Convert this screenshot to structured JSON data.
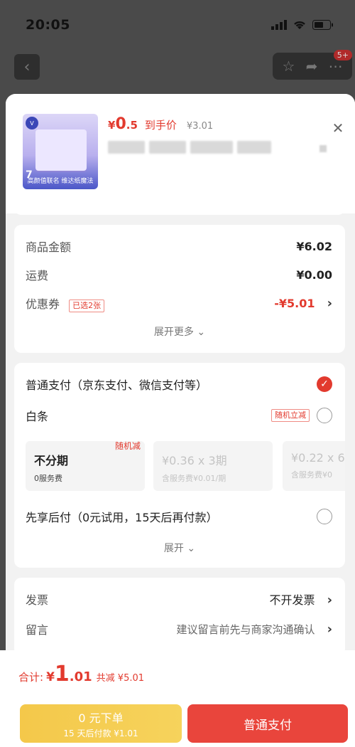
{
  "status_bar": {
    "time": "20:05"
  },
  "background_nav": {
    "badge": "5+"
  },
  "product": {
    "price_currency": "¥",
    "price_int": "0",
    "price_dec": ".5",
    "price_tag": "到手价",
    "original_price": "¥3.01",
    "thumb_num": "7",
    "thumb_caption": "高颜值联名 维达纸魔法"
  },
  "summary": {
    "goods_label": "商品金额",
    "goods_value": "¥6.02",
    "shipping_label": "运费",
    "shipping_value": "¥0.00",
    "coupon_label": "优惠券",
    "coupon_tag": "已选2张",
    "coupon_value": "-¥5.01",
    "expand_more": "展开更多"
  },
  "payment": {
    "normal_label": "普通支付（京东支付、微信支付等）",
    "baitiao_label": "白条",
    "baitiao_badge": "随机立减",
    "installments": [
      {
        "main": "不分期",
        "sub": "0服务费",
        "badge": "随机减"
      },
      {
        "main": "¥0.36 x 3期",
        "sub": "含服务费¥0.01/期"
      },
      {
        "main": "¥0.22 x 6",
        "sub": "含服务费¥0"
      }
    ],
    "later_label": "先享后付（0元试用，15天后再付款）",
    "expand": "展开"
  },
  "extra": {
    "invoice_label": "发票",
    "invoice_value": "不开发票",
    "note_label": "留言",
    "note_value": "建议留言前先与商家沟通确认"
  },
  "footer": {
    "total_label": "合计:",
    "total_cur": "¥",
    "total_int": "1",
    "total_dec": ".01",
    "total_save": "共减 ¥5.01",
    "yellow_l1": "0 元下单",
    "yellow_l2": "15 天后付款 ¥1.01",
    "red_label": "普通支付"
  },
  "colors": {
    "accent": "#e23a2e",
    "yellow": "#f4c84a",
    "sheet_bg": "#f2f2f2"
  }
}
